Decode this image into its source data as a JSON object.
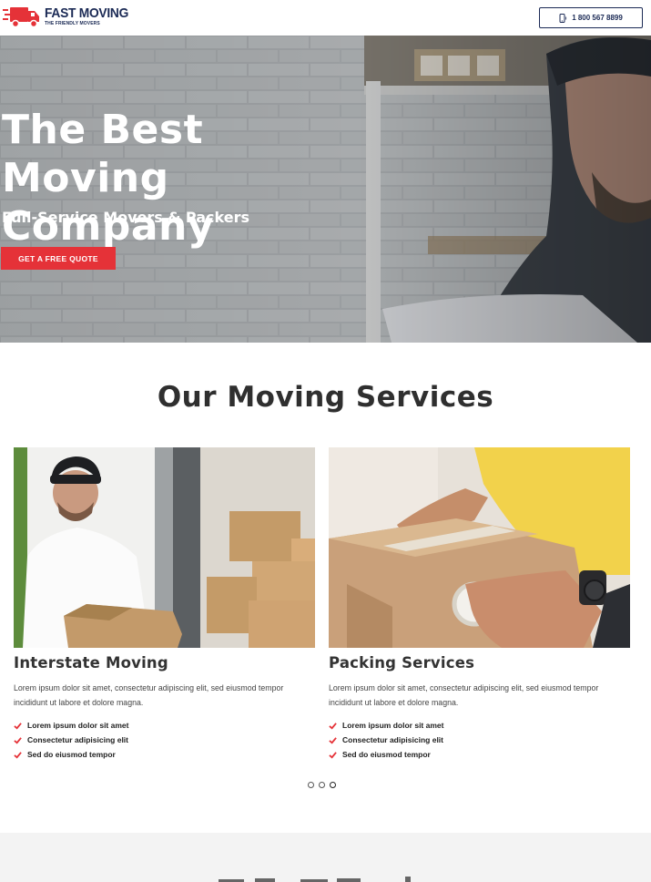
{
  "header": {
    "logo_title": "FAST MOVING",
    "logo_subtitle": "THE FRIENDLY MOVERS",
    "phone": "1 800 567 8899",
    "icons": {
      "logo": "truck-icon",
      "phone": "mobile-phone-icon"
    },
    "colors": {
      "brand": "#1b2a55",
      "accent": "#e53238"
    }
  },
  "hero": {
    "title": "The Best Moving Company",
    "subtitle": "Full-Service Movers & Packers",
    "cta_label": "GET A FREE QUOTE"
  },
  "services": {
    "heading": "Our Moving Services",
    "cards": [
      {
        "title": "Interstate Moving",
        "description": "Lorem ipsum dolor sit amet, consectetur adipiscing elit, sed eiusmod tempor incididunt ut labore et dolore magna.",
        "features": [
          "Lorem ipsum dolor sit amet",
          "Consectetur adipisicing elit",
          "Sed do eiusmod tempor"
        ]
      },
      {
        "title": "Packing Services",
        "description": "Lorem ipsum dolor sit amet, consectetur adipiscing elit, sed eiusmod tempor incididunt ut labore et dolore magna.",
        "features": [
          "Lorem ipsum dolor sit amet",
          "Consectetur adipisicing elit",
          "Sed do eiusmod tempor"
        ]
      }
    ],
    "carousel": {
      "total_pages": 3,
      "active_page": 3
    }
  }
}
